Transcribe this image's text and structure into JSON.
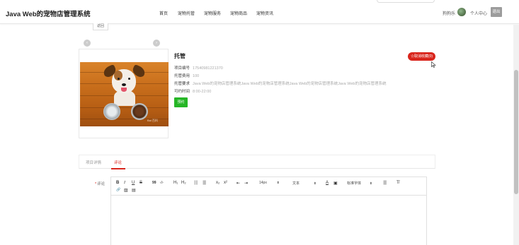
{
  "header": {
    "brand": "Java Web的宠物店管理系统",
    "nav": [
      "首页",
      "宠物托管",
      "宠物服务",
      "宠物商品",
      "宠物资讯"
    ],
    "username": "狗狗乐",
    "center": "个人中心",
    "logout": "退出"
  },
  "back_label": "返回",
  "detail": {
    "title": "托管",
    "favorite": "☆取消收藏(0)",
    "fields": [
      {
        "label": "项目编号",
        "value": "17540981221370"
      },
      {
        "label": "托管费用",
        "value": "100"
      },
      {
        "label": "托管要求",
        "value": "Java Web的宠物店管理系统Java Web的宠物店管理系统Java Web的宠物店管理系统Java Web的宠物店管理系统"
      },
      {
        "label": "可约时间",
        "value": "8:00-22:00"
      }
    ],
    "book": "预约",
    "watermark": "Bai 百科"
  },
  "tabs": {
    "detail": "项目详情",
    "comment": "评论"
  },
  "comment": {
    "required": "*",
    "label": "评论"
  },
  "editor_toolbar": {
    "bold": "B",
    "italic": "I",
    "underline": "U",
    "strike": "S",
    "quote": "99",
    "code": "‹/›",
    "h1": "H₁",
    "h2": "H₂",
    "ordered": "☷",
    "bullet": "☰",
    "sub": "x₂",
    "sup": "x²",
    "outdent": "⇤",
    "indent": "⇥",
    "size": "14px",
    "header": "文本",
    "color": "A",
    "background": "▣",
    "font": "标准字体",
    "align": "☰",
    "clean": "T̸",
    "link": "🔗",
    "image": "▨",
    "video": "▤"
  },
  "colors": {
    "accent": "#d9251c",
    "book": "#26b626",
    "logout": "#9c9c9c"
  }
}
